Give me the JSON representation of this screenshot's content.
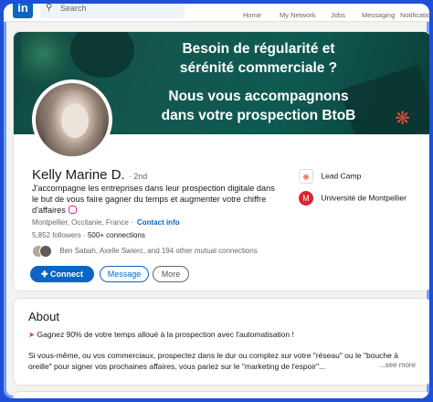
{
  "nav": {
    "logo": "in",
    "search_placeholder": "Search",
    "items": [
      {
        "label": "Home",
        "icon": "home-icon"
      },
      {
        "label": "My Network",
        "icon": "network-icon"
      },
      {
        "label": "Jobs",
        "icon": "briefcase-icon"
      },
      {
        "label": "Messaging",
        "icon": "message-icon"
      },
      {
        "label": "Notificatio",
        "icon": "bell-icon"
      }
    ]
  },
  "banner": {
    "line1": "Besoin de régularité et",
    "line2": "sérénité commerciale ?",
    "line3": "Nous vous accompagnons",
    "line4": "dans votre prospection BtoB"
  },
  "profile": {
    "name": "Kelly Marine D.",
    "degree": "· 2nd",
    "headline": "J'accompagne les entreprises dans leur prospection digitale dans le but de vous faire gagner du temps et augmenter votre chiffre d'affaires",
    "location": "Montpellier, Occitanie, France ·",
    "contact_info": "Contact info",
    "followers": "5,852 followers",
    "connections": "500+ connections",
    "mutual": "Ben Sabah, Axelle Swierc, and 194 other mutual connections",
    "company": "Lead Camp",
    "school": "Université de Montpellier"
  },
  "actions": {
    "connect": "Connect",
    "message": "Message",
    "more": "More"
  },
  "about": {
    "title": "About",
    "line1": "Gagnez 90% de votre temps alloué à la prospection avec l'automatisation !",
    "line2": "Si vous-même, ou vos commerciaux, prospectez dans le dur ou comptez sur votre \"réseau\" ou le \"bouche à oreille\" pour signer vos prochaines affaires, vous pariez sur le \"marketing de l'espoir\"...",
    "see_more": "...see more"
  },
  "colors": {
    "brand": "#0a66c2",
    "frame": "#1d4fd8",
    "banner": "#14574f"
  }
}
